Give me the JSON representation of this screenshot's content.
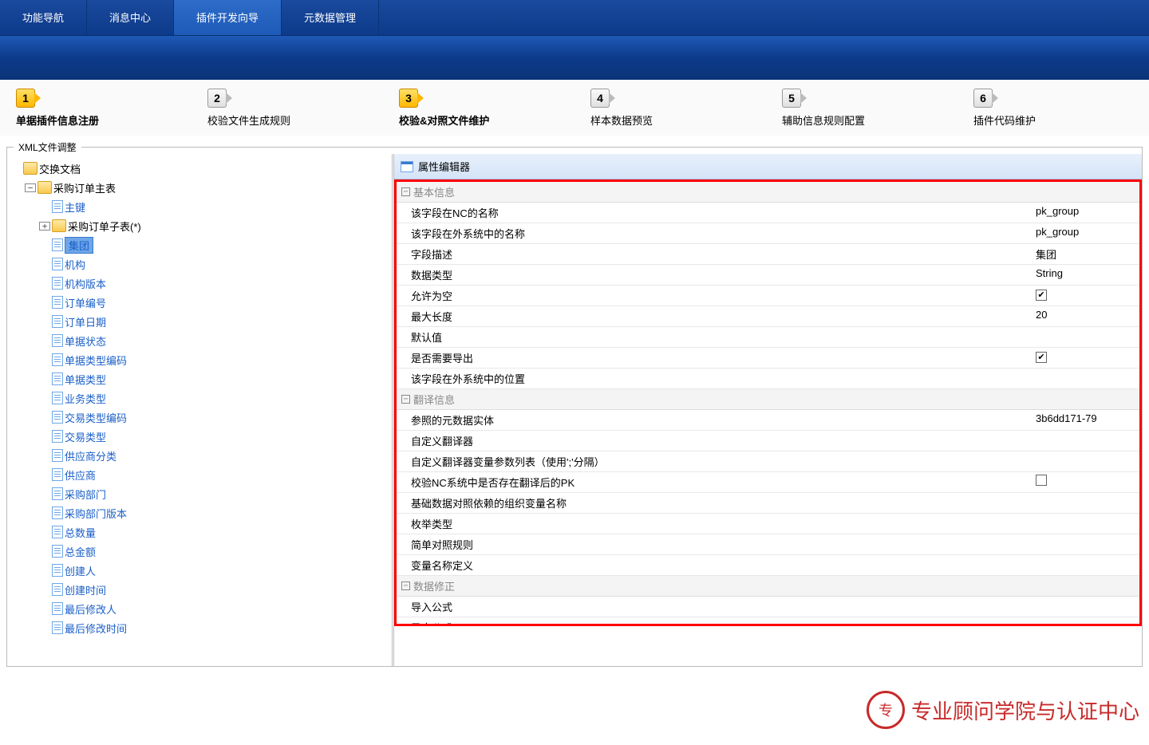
{
  "topTabs": [
    "功能导航",
    "消息中心",
    "插件开发向导",
    "元数据管理"
  ],
  "activeTopTab": 2,
  "wizard": {
    "steps": [
      {
        "num": "1",
        "label": "单据插件信息注册",
        "active": true
      },
      {
        "num": "2",
        "label": "校验文件生成规则",
        "active": false
      },
      {
        "num": "3",
        "label": "校验&对照文件维护",
        "active": true
      },
      {
        "num": "4",
        "label": "样本数据预览",
        "active": false
      },
      {
        "num": "5",
        "label": "辅助信息规则配置",
        "active": false
      },
      {
        "num": "6",
        "label": "插件代码维护",
        "active": false
      }
    ]
  },
  "fieldsetLegend": "XML文件调整",
  "tree": {
    "root": "交换文档",
    "main": "采购订单主表",
    "pk": "主键",
    "sub": "采购订单子表(*)",
    "fields": [
      "集团",
      "机构",
      "机构版本",
      "订单编号",
      "订单日期",
      "单据状态",
      "单据类型编码",
      "单据类型",
      "业务类型",
      "交易类型编码",
      "交易类型",
      "供应商分类",
      "供应商",
      "采购部门",
      "采购部门版本",
      "总数量",
      "总金额",
      "创建人",
      "创建时间",
      "最后修改人",
      "最后修改时间"
    ],
    "selectedIndex": 0
  },
  "propEditor": {
    "title": "属性编辑器",
    "sections": [
      {
        "name": "基本信息",
        "rows": [
          {
            "label": "该字段在NC的名称",
            "value": "pk_group"
          },
          {
            "label": "该字段在外系统中的名称",
            "value": "pk_group"
          },
          {
            "label": "字段描述",
            "value": "集团"
          },
          {
            "label": "数据类型",
            "value": "String"
          },
          {
            "label": "允许为空",
            "type": "check",
            "checked": true
          },
          {
            "label": "最大长度",
            "value": "20"
          },
          {
            "label": "默认值",
            "value": ""
          },
          {
            "label": "是否需要导出",
            "type": "check",
            "checked": true
          },
          {
            "label": "该字段在外系统中的位置",
            "value": ""
          }
        ]
      },
      {
        "name": "翻译信息",
        "rows": [
          {
            "label": "参照的元数据实体",
            "value": "3b6dd171-79"
          },
          {
            "label": "自定义翻译器",
            "value": ""
          },
          {
            "label": "自定义翻译器变量参数列表（使用';'分隔）",
            "value": ""
          },
          {
            "label": "校验NC系统中是否存在翻译后的PK",
            "type": "check",
            "checked": false
          },
          {
            "label": "基础数据对照依赖的组织变量名称",
            "value": ""
          },
          {
            "label": "枚举类型",
            "value": ""
          },
          {
            "label": "简单对照规则",
            "value": ""
          },
          {
            "label": "变量名称定义",
            "value": ""
          }
        ]
      },
      {
        "name": "数据修正",
        "rows": [
          {
            "label": "导入公式",
            "value": ""
          },
          {
            "label": "导出公式",
            "value": ""
          }
        ]
      }
    ]
  },
  "watermark": "专业顾问学院与认证中心"
}
